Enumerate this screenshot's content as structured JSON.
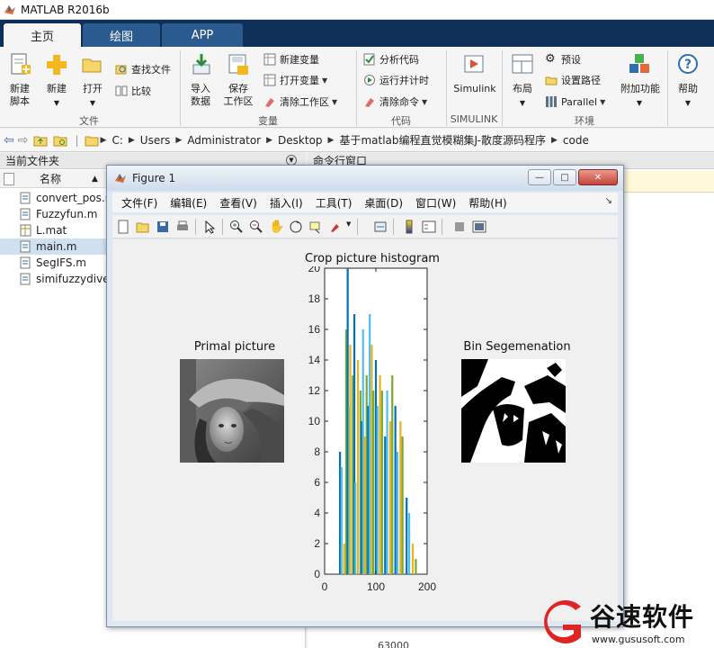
{
  "app": {
    "title": "MATLAB R2016b"
  },
  "tabs": [
    "主页",
    "绘图",
    "APP"
  ],
  "ribbon": {
    "new_script": "新建\n脚本",
    "new": "新建",
    "open": "打开",
    "find_files": "查找文件",
    "compare": "比较",
    "import_data": "导入\n数据",
    "save_workspace": "保存\n工作区",
    "new_variable": "新建变量",
    "open_variable": "打开变量",
    "clear_workspace": "清除工作区",
    "analyze_code": "分析代码",
    "run_and_time": "运行并计时",
    "clear_commands": "清除命令",
    "simulink": "Simulink",
    "layout": "布局",
    "preferences": "预设",
    "set_path": "设置路径",
    "parallel": "Parallel",
    "addons": "附加功能",
    "help": "帮助",
    "groups": [
      "文件",
      "变量",
      "代码",
      "SIMULINK",
      "环境"
    ]
  },
  "address": [
    "C:",
    "Users",
    "Administrator",
    "Desktop",
    "基于matlab编程直觉模糊集J-散度源码程序",
    "code"
  ],
  "folder_panel": {
    "title": "当前文件夹",
    "col_name": "名称",
    "sort_indicator": "▲",
    "files": [
      {
        "name": "convert_pos.m",
        "type": "m",
        "selected": false
      },
      {
        "name": "Fuzzyfun.m",
        "type": "m",
        "selected": false
      },
      {
        "name": "L.mat",
        "type": "mat",
        "selected": false
      },
      {
        "name": "main.m",
        "type": "m",
        "selected": true
      },
      {
        "name": "SegIFS.m",
        "type": "m",
        "selected": false
      },
      {
        "name": "simifuzzydive",
        "type": "m",
        "selected": false
      }
    ]
  },
  "command_panel": {
    "title": "命令行窗口"
  },
  "figure": {
    "title": "Figure 1",
    "menus": [
      "文件(F)",
      "编辑(E)",
      "查看(V)",
      "插入(I)",
      "工具(T)",
      "桌面(D)",
      "窗口(W)",
      "帮助(H)"
    ],
    "min_label": "—",
    "max_label": "□",
    "close_label": "✕",
    "primal_title": "Primal picture",
    "bin_title": "Bin Segemenation"
  },
  "chart_data": {
    "type": "bar",
    "title": "Crop picture histogram",
    "xlabel": "",
    "ylabel": "",
    "xlim": [
      0,
      200
    ],
    "ylim": [
      0,
      20
    ],
    "xticks": [
      0,
      100,
      200
    ],
    "yticks": [
      0,
      2,
      4,
      6,
      8,
      10,
      12,
      14,
      16,
      18,
      20
    ],
    "colors": [
      "#0072bd",
      "#4dbeee",
      "#edb120",
      "#77ac30"
    ],
    "x": [
      30,
      33,
      38,
      42,
      45,
      48,
      50,
      55,
      58,
      60,
      65,
      70,
      72,
      75,
      78,
      82,
      85,
      88,
      92,
      95,
      100,
      103,
      108,
      112,
      118,
      122,
      128,
      132,
      138,
      142,
      148,
      152,
      160,
      165,
      172,
      178
    ],
    "values": [
      8,
      7,
      2,
      16,
      20,
      11,
      15,
      13,
      17,
      6,
      14,
      12,
      10,
      16,
      9,
      13,
      11,
      17,
      15,
      12,
      14,
      11,
      13,
      12,
      9,
      12,
      10,
      13,
      11,
      8,
      10,
      9,
      5,
      4,
      2,
      1
    ]
  },
  "watermark": {
    "text": "谷速软件",
    "url": "www.gususoft.com"
  },
  "bottom_partial": "63000"
}
